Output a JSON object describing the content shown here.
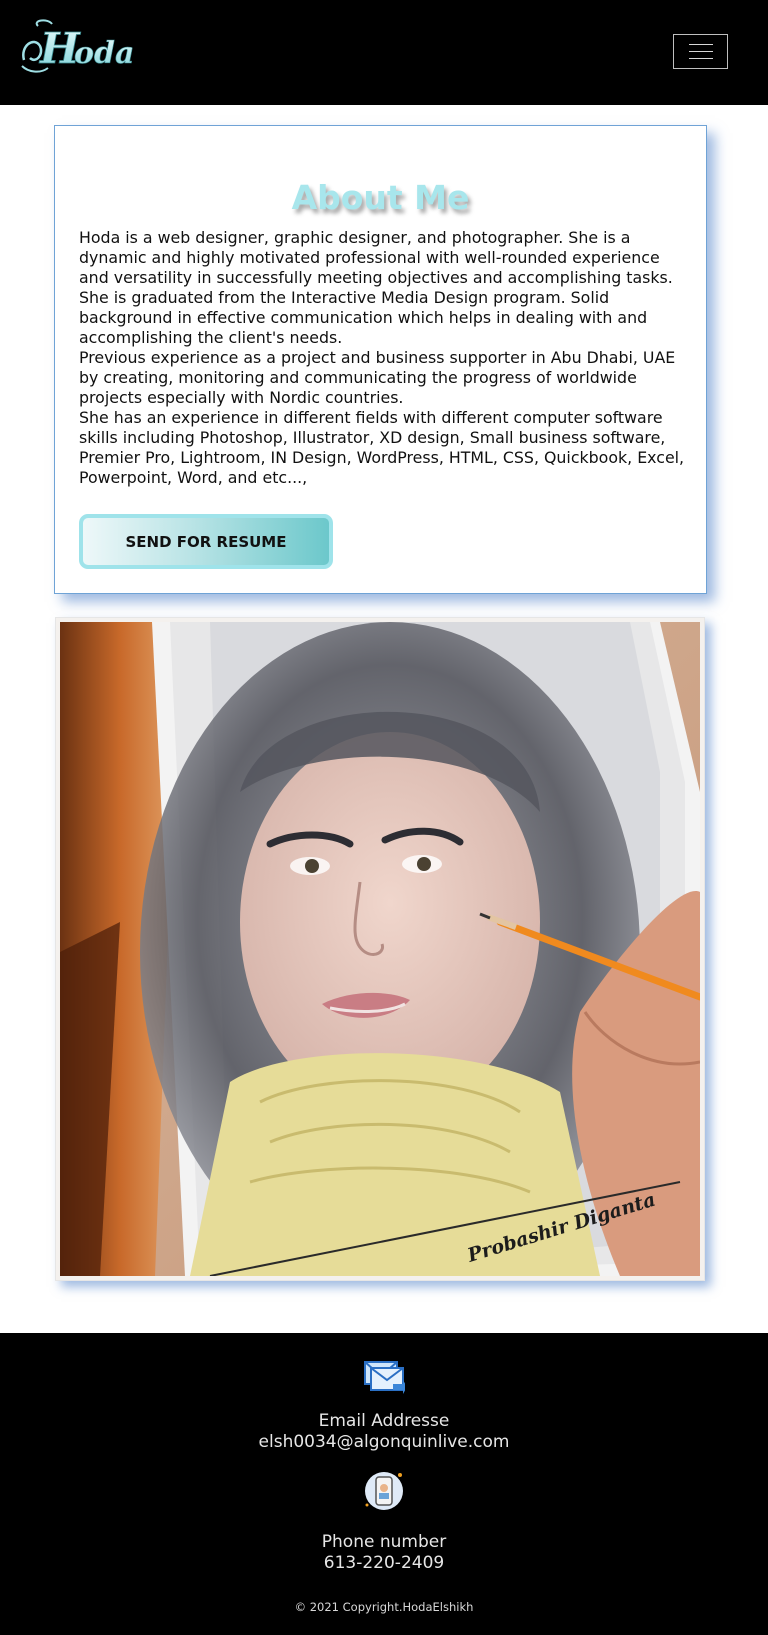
{
  "header": {
    "logo_text": "Hoda",
    "menu_icon": "hamburger-menu-icon"
  },
  "about": {
    "title": "About Me",
    "paragraphs": [
      "Hoda is a web designer, graphic designer, and photographer. She is a dynamic and highly motivated professional with well-rounded experience and versatility in successfully meeting objectives and accomplishing tasks.",
      "She is graduated from the Interactive Media Design program. Solid background in effective communication which helps in dealing with and accomplishing the client's needs.",
      "Previous experience as a project and business supporter in Abu Dhabi, UAE by creating, monitoring and communicating the progress of worldwide projects especially with Nordic countries.",
      "She has an experience in different fields with different computer software skills including Photoshop, Illustrator, XD design, Small business software, Premier Pro, Lightroom, IN Design, WordPress, HTML, CSS, Quickbook, Excel, Powerpoint, Word, and etc...,"
    ],
    "resume_button": "SEND FOR RESUME"
  },
  "photo": {
    "signature": "Probashir Diganta"
  },
  "footer": {
    "email_icon": "envelope-icon",
    "email_label": "Email Addresse",
    "email_value": "elsh0034@algonquinlive.com",
    "phone_icon": "phone-icon",
    "phone_label": "Phone number",
    "phone_value": "613-220-2409",
    "copyright": "© 2021 Copyright.HodaElshikh"
  },
  "colors": {
    "header_bg": "#000000",
    "accent": "#a8e6ec",
    "card_border": "#6fa3d6"
  }
}
